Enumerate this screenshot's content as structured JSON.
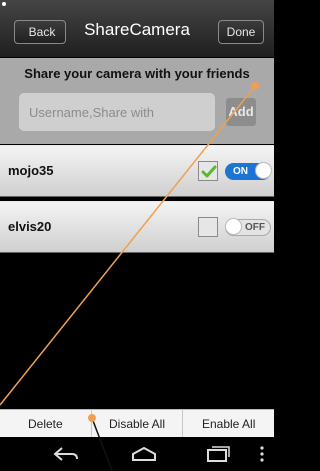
{
  "header": {
    "back_label": "Back",
    "title": "ShareCamera",
    "done_label": "Done"
  },
  "share": {
    "heading": "Share your camera with your friends",
    "placeholder": "Username,Share with",
    "add_label": "Add"
  },
  "friends": [
    {
      "name": "mojo35",
      "checked": true,
      "toggle": "ON"
    },
    {
      "name": "elvis20",
      "checked": false,
      "toggle": "OFF"
    }
  ],
  "actions": {
    "delete_label": "Delete",
    "disable_all_label": "Disable All",
    "enable_all_label": "Enable All"
  },
  "navbar": {
    "icons": [
      "back-nav-icon",
      "home-nav-icon",
      "recent-apps-icon",
      "menu-dots-icon"
    ]
  },
  "colors": {
    "toggle_on": "#1e74d4",
    "check_green": "#5cb82e",
    "annotation": "#f0a050"
  }
}
